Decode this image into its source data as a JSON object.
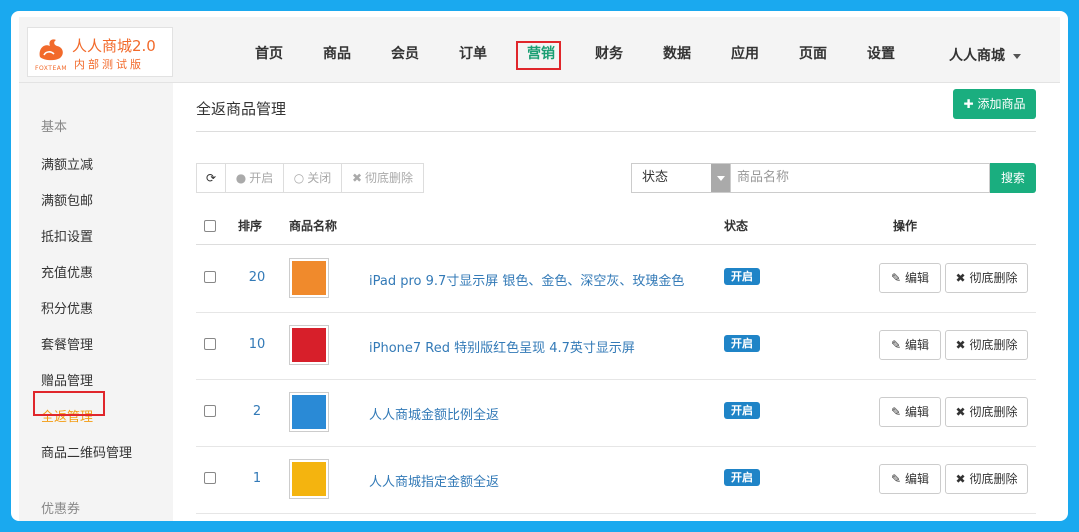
{
  "brand": {
    "name": "人人商城2.0",
    "subtitle": "内部测试版",
    "foxteam": "FOXTEAM"
  },
  "nav": {
    "items": [
      "首页",
      "商品",
      "会员",
      "订单",
      "营销",
      "财务",
      "数据",
      "应用",
      "页面",
      "设置"
    ],
    "active": "营销",
    "store_label": "人人商城"
  },
  "sidebar": {
    "section_basic": "基本",
    "items": [
      "满额立减",
      "满额包邮",
      "抵扣设置",
      "充值优惠",
      "积分优惠",
      "套餐管理",
      "赠品管理",
      "全返管理",
      "商品二维码管理"
    ],
    "active": "全返管理",
    "section_coupon": "优惠券"
  },
  "main": {
    "title": "全返商品管理",
    "add_button": "添加商品",
    "toolbar": {
      "refresh": "",
      "enable": "开启",
      "disable": "关闭",
      "delete": "彻底删除"
    },
    "filter": {
      "status_select": "状态",
      "search_placeholder": "商品名称",
      "search_button": "搜索"
    },
    "table": {
      "headers": {
        "sort": "排序",
        "name": "商品名称",
        "status": "状态",
        "actions": "操作"
      },
      "edit_label": "编辑",
      "delete_label": "彻底删除",
      "rows": [
        {
          "sort": "20",
          "name": "iPad pro 9.7寸显示屏 银色、金色、深空灰、玫瑰金色",
          "status": "开启",
          "thumb_color": "#f08a2c"
        },
        {
          "sort": "10",
          "name": "iPhone7 Red 特别版红色呈现 4.7英寸显示屏",
          "status": "开启",
          "thumb_color": "#d71f2a"
        },
        {
          "sort": "2",
          "name": "人人商城金额比例全返",
          "status": "开启",
          "thumb_color": "#2a8ad6"
        },
        {
          "sort": "1",
          "name": "人人商城指定金额全返",
          "status": "开启",
          "thumb_color": "#f4b40f"
        }
      ]
    }
  },
  "colors": {
    "frame_bg": "#1aa9ef",
    "accent_green": "#1aae7f",
    "brand_orange": "#f26a2b",
    "status_blue": "#1f84c7",
    "highlight_red": "#e0262b",
    "sidebar_active": "#f39c12"
  }
}
